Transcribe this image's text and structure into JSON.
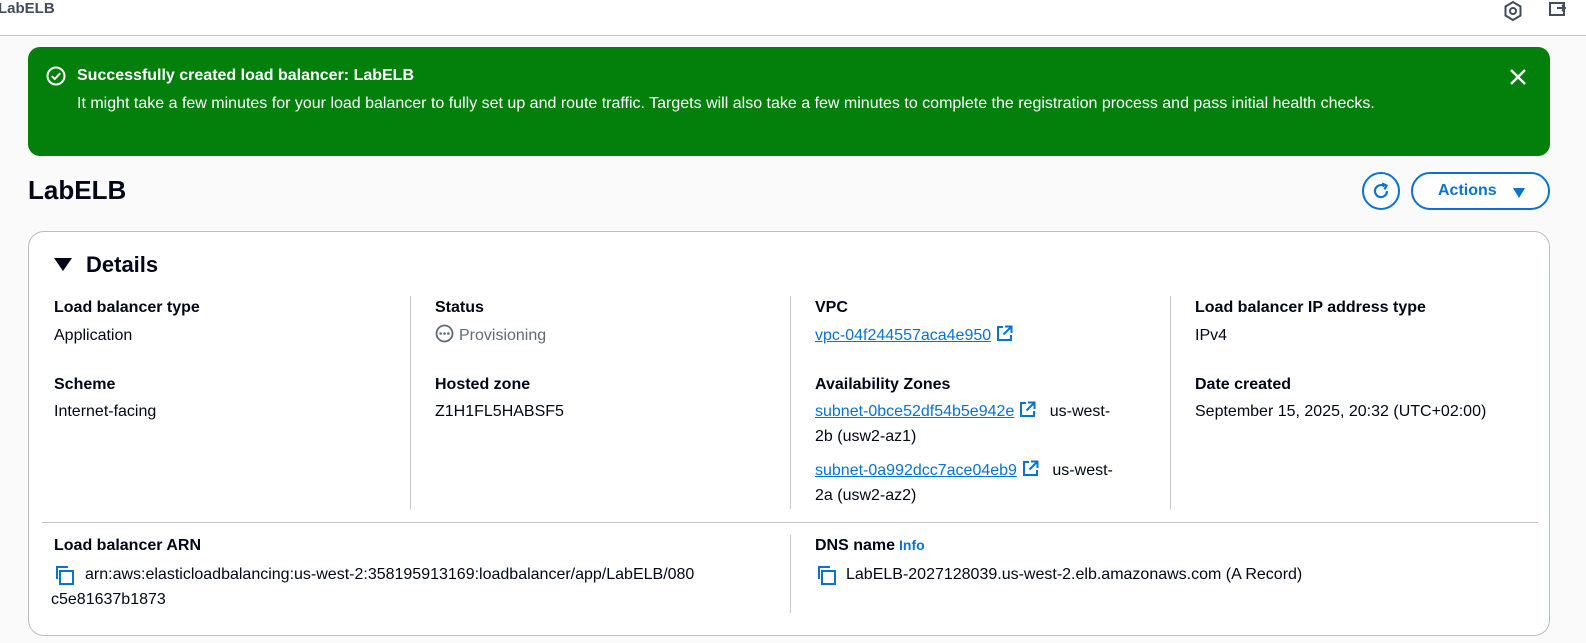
{
  "topbar": {
    "title": "LabELB"
  },
  "banner": {
    "title_prefix": "Successfully created load balancer: ",
    "title_name": "LabELB",
    "message": "It might take a few minutes for your load balancer to fully set up and route traffic. Targets will also take a few minutes to complete the registration process and pass initial health checks."
  },
  "page": {
    "title": "LabELB",
    "actions_label": "Actions"
  },
  "details": {
    "header": "Details",
    "lb_type": {
      "label": "Load balancer type",
      "value": "Application"
    },
    "scheme": {
      "label": "Scheme",
      "value": "Internet-facing"
    },
    "status": {
      "label": "Status",
      "value": "Provisioning"
    },
    "hosted_zone": {
      "label": "Hosted zone",
      "value": "Z1H1FL5HABSF5"
    },
    "vpc": {
      "label": "VPC",
      "value": "vpc-04f244557aca4e950"
    },
    "azs": {
      "label": "Availability Zones",
      "items": [
        {
          "subnet": "subnet-0bce52df54b5e942e",
          "zone_a": "us-west-",
          "zone_b": "2b (usw2-az1)"
        },
        {
          "subnet": "subnet-0a992dcc7ace04eb9",
          "zone_a": "us-west-",
          "zone_b": "2a (usw2-az2)"
        }
      ]
    },
    "ip_type": {
      "label": "Load balancer IP address type",
      "value": "IPv4"
    },
    "date_created": {
      "label": "Date created",
      "value": "September 15, 2025, 20:32 (UTC+02:00)"
    },
    "arn": {
      "label": "Load balancer ARN",
      "line1": "arn:aws:elasticloadbalancing:us-west-2:358195913169:loadbalancer/app/LabELB/080",
      "line2": "c5e81637b1873"
    },
    "dns": {
      "label": "DNS name",
      "info": "Info",
      "value": "LabELB-2027128039.us-west-2.elb.amazonaws.com (A Record)"
    }
  },
  "colors": {
    "success_green": "#037f0c",
    "link_blue": "#0972d3"
  }
}
